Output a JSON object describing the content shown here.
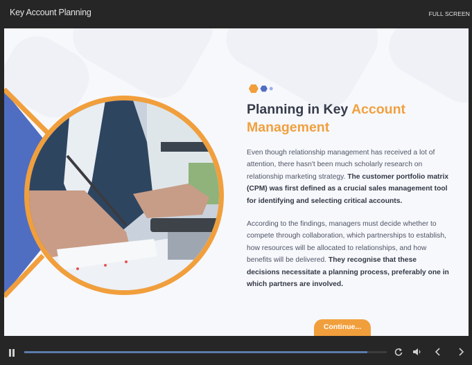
{
  "window": {
    "title": "Key Account Planning",
    "fullscreen_label": "FULL SCREEN"
  },
  "colors": {
    "accent_orange": "#f19f3c",
    "accent_blue": "#4f6ec2",
    "dot_light_blue": "#9aaee6",
    "heading_dark": "#353b4a"
  },
  "slide": {
    "decor_dots": [
      "orange-hexagon",
      "blue-hexagon",
      "light-blue-dot"
    ],
    "heading_part1": "Planning in Key ",
    "heading_part2": "Account Management",
    "paragraph1_normal": "Even though relationship management has received a lot of attention, there hasn't been much scholarly research on relationship marketing strategy. ",
    "paragraph1_bold": "The customer portfolio matrix (CPM) was first defined as a crucial sales management tool for identifying and selecting critical accounts.",
    "paragraph2_normal": "According to the findings, managers must decide whether to compete through collaboration, which partnerships to establish, how resources will be allocated to relationships, and how benefits will be delivered. ",
    "paragraph2_bold": "They recognise that these decisions necessitate a planning process, preferably one in which partners are involved.",
    "image_description": "Businessman writing on notepad while using a calculator",
    "continue_label": "Continue..."
  },
  "player": {
    "progress_percent": 94.6,
    "controls": [
      "pause-icon",
      "replay-icon",
      "volume-icon",
      "previous-icon",
      "next-icon"
    ]
  }
}
